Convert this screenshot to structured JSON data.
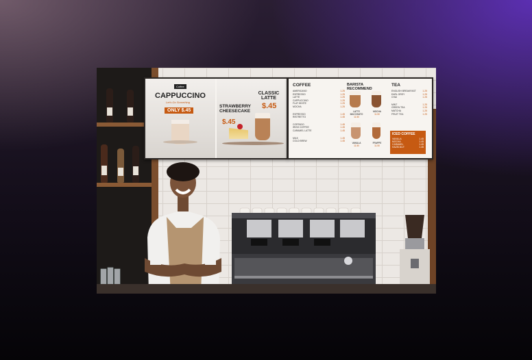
{
  "left_sign": {
    "promo1": {
      "logo_text": "Coffee",
      "title": "CAPPUCCINO",
      "script": "Let's Go Something",
      "price_badge": "ONLY $.45"
    },
    "promo2": {
      "title": "STRAWBERRY CHEESECAKE",
      "price": "$.45"
    },
    "promo3": {
      "title": "CLASSIC LATTE",
      "price": "$.45"
    }
  },
  "right_sign": {
    "coffee": {
      "heading": "COFFEE",
      "items": [
        {
          "name": "AMERICANO",
          "price": "1.25"
        },
        {
          "name": "ESPRESSO",
          "price": "1.25"
        },
        {
          "name": "LATTE",
          "price": "1.25"
        },
        {
          "name": "CAPPUCCINO",
          "price": "1.25"
        },
        {
          "name": "FLAT WHITE",
          "price": "1.25"
        },
        {
          "name": "MOCHA",
          "price": "1.25"
        },
        {
          "name": "ESPRESSO",
          "price": "1.45"
        },
        {
          "name": "RISTRETTO",
          "price": "1.45"
        },
        {
          "name": "CORTADO",
          "price": "1.45"
        },
        {
          "name": "IRISH COFFEE",
          "price": "1.45"
        },
        {
          "name": "CARAMEL LATTE",
          "price": "1.45"
        },
        {
          "name": "MILK",
          "price": "1.45"
        },
        {
          "name": "COLD BREW",
          "price": "1.45"
        }
      ]
    },
    "barista": {
      "heading": "BARISTA RECOMMEND",
      "items": [
        {
          "name": "LATTE MACCHIATO",
          "price": "11.50"
        },
        {
          "name": "MOCHA",
          "price": "11.50"
        },
        {
          "name": "VANILLA",
          "price": "11.50"
        },
        {
          "name": "FRAPPE",
          "price": "11.50"
        }
      ]
    },
    "tea": {
      "heading": "TEA",
      "items": [
        {
          "name": "ENGLISH BREAKFAST",
          "price": "1.25"
        },
        {
          "name": "EARL GREY",
          "price": "1.25"
        },
        {
          "name": "CHAI",
          "price": "1.25"
        },
        {
          "name": "MINT",
          "price": "1.25"
        },
        {
          "name": "GREEN TEA",
          "price": "1.25"
        },
        {
          "name": "MATCHA",
          "price": "1.25"
        },
        {
          "name": "FRUIT TEA",
          "price": "1.25"
        }
      ]
    },
    "iced": {
      "heading": "ICED COFFEE",
      "items": [
        {
          "name": "VANILLA",
          "price": "1.45"
        },
        {
          "name": "MOCHA",
          "price": "1.45"
        },
        {
          "name": "CARAMEL",
          "price": "1.45"
        },
        {
          "name": "HAZELNUT",
          "price": "1.45"
        }
      ]
    }
  },
  "colors": {
    "accent": "#c65a12",
    "background_glow": "#6432c8"
  }
}
